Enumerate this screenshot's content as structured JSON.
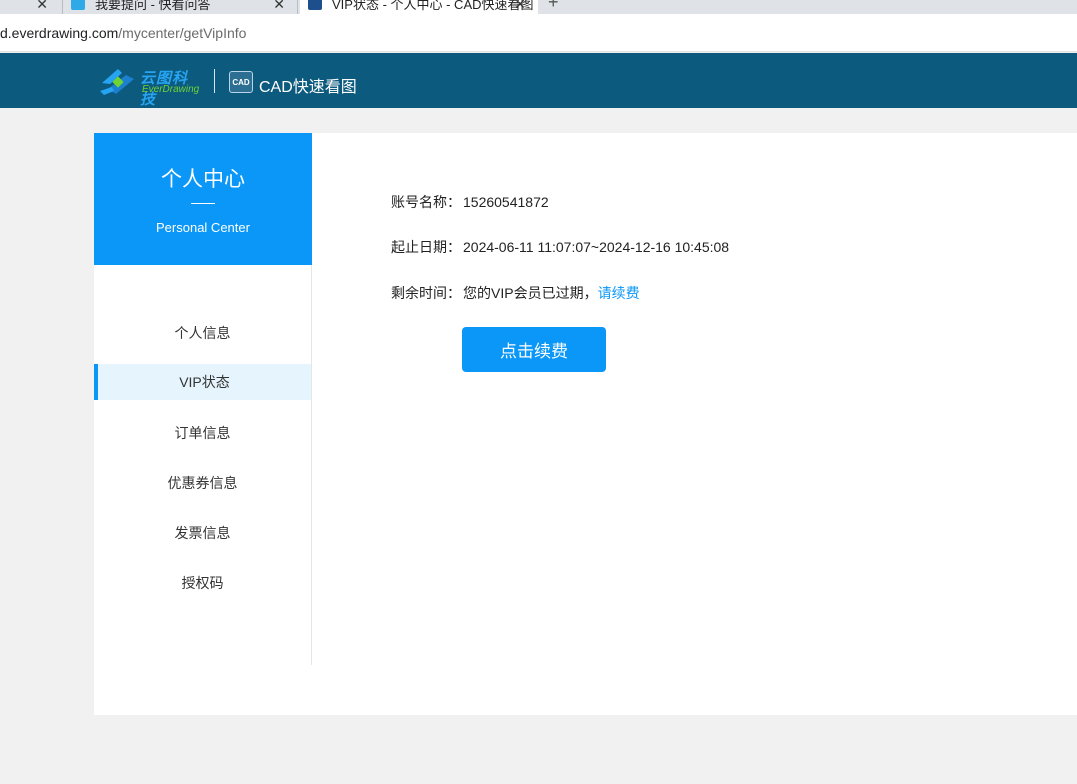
{
  "browser": {
    "tabs": [
      {
        "title": "",
        "close": "✕"
      },
      {
        "title": "我要提问 - 快看问答",
        "close": "✕"
      },
      {
        "title": "VIP状态 - 个人中心 - CAD快速看图",
        "close": "✕"
      }
    ],
    "new_tab": "+",
    "url_host": "d.everdrawing.com",
    "url_path": "/mycenter/getVipInfo"
  },
  "header": {
    "logo_cn": "云图科技",
    "logo_en": "EverDrawing",
    "app_icon_text": "CAD",
    "app_title": "CAD快速看图"
  },
  "sidebar": {
    "title": "个人中心",
    "subtitle": "Personal Center",
    "items": [
      {
        "label": "个人信息"
      },
      {
        "label": "VIP状态"
      },
      {
        "label": "订单信息"
      },
      {
        "label": "优惠券信息"
      },
      {
        "label": "发票信息"
      },
      {
        "label": "授权码"
      }
    ]
  },
  "vip": {
    "account_label": "账号名称：",
    "account_value": "15260541872",
    "period_label": "起止日期：",
    "period_value": "2024-06-11 11:07:07~2024-12-16 10:45:08",
    "remaining_label": "剩余时间：",
    "remaining_value": "您的VIP会员已过期，",
    "renew_link": "请续费",
    "renew_button": "点击续费"
  },
  "colors": {
    "header_bg": "#0c5a7e",
    "accent": "#0a97f7"
  }
}
